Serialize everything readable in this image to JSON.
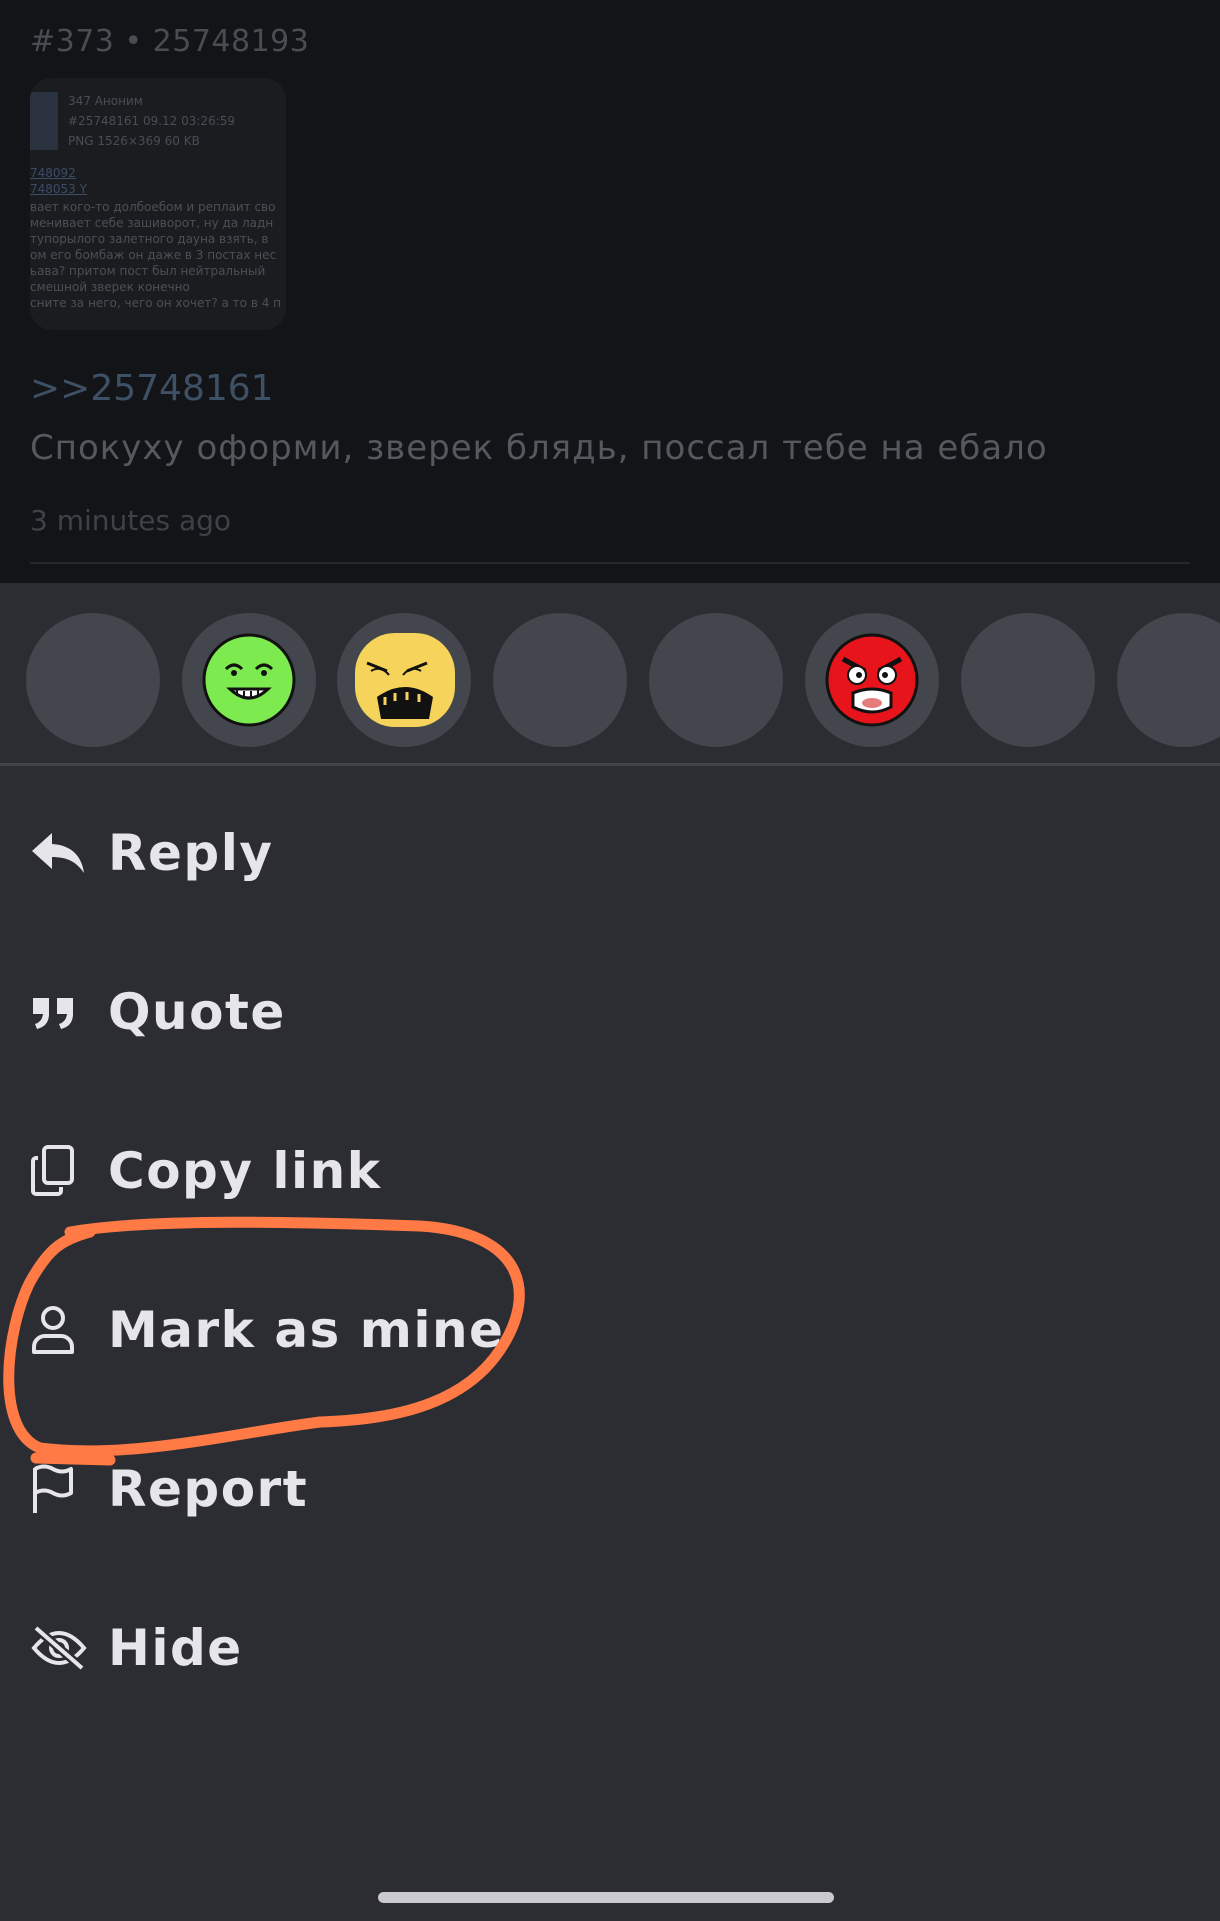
{
  "post": {
    "header": "#373 • 25748193",
    "thumbnail": {
      "meta_line1": "347 Аноним",
      "meta_line2": "#25748161 09.12 03:26:59",
      "meta_line3": "PNG 1526×369 60 KB",
      "link1": "748092",
      "link2": "748053 Y",
      "text_lines": [
        "вает кого-то долбоебом и реплаит сво",
        "менивает себе зашиворот, ну да ладн",
        "тупорылого залетного дауна взять, в",
        "ом его бомбаж он даже в 3 постах нес",
        "ьава? притом пост был нейтральный",
        "смешной зверек конечно",
        "сните за него, чего он хочет? а то в 4 п"
      ]
    },
    "quote_ref": ">>25748161",
    "text": "Спокуху оформи, зверек блядь, поссал тебе на ебало",
    "time": "3 minutes ago"
  },
  "reactions": [
    {
      "name": "empty"
    },
    {
      "name": "green-troll-face"
    },
    {
      "name": "yellow-rage-face"
    },
    {
      "name": "empty"
    },
    {
      "name": "empty"
    },
    {
      "name": "red-angry-face"
    },
    {
      "name": "empty"
    },
    {
      "name": "empty"
    }
  ],
  "menu": {
    "reply": "Reply",
    "quote": "Quote",
    "copy_link": "Copy link",
    "mark_as_mine": "Mark as mine",
    "report": "Report",
    "hide": "Hide"
  },
  "colors": {
    "sheet_background": "#2c2d33",
    "annotation": "#ff7a45",
    "menu_text": "#e6e6ea"
  },
  "icons": [
    "reply-icon",
    "quote-icon",
    "copy-icon",
    "person-icon",
    "flag-icon",
    "eye-off-icon"
  ]
}
